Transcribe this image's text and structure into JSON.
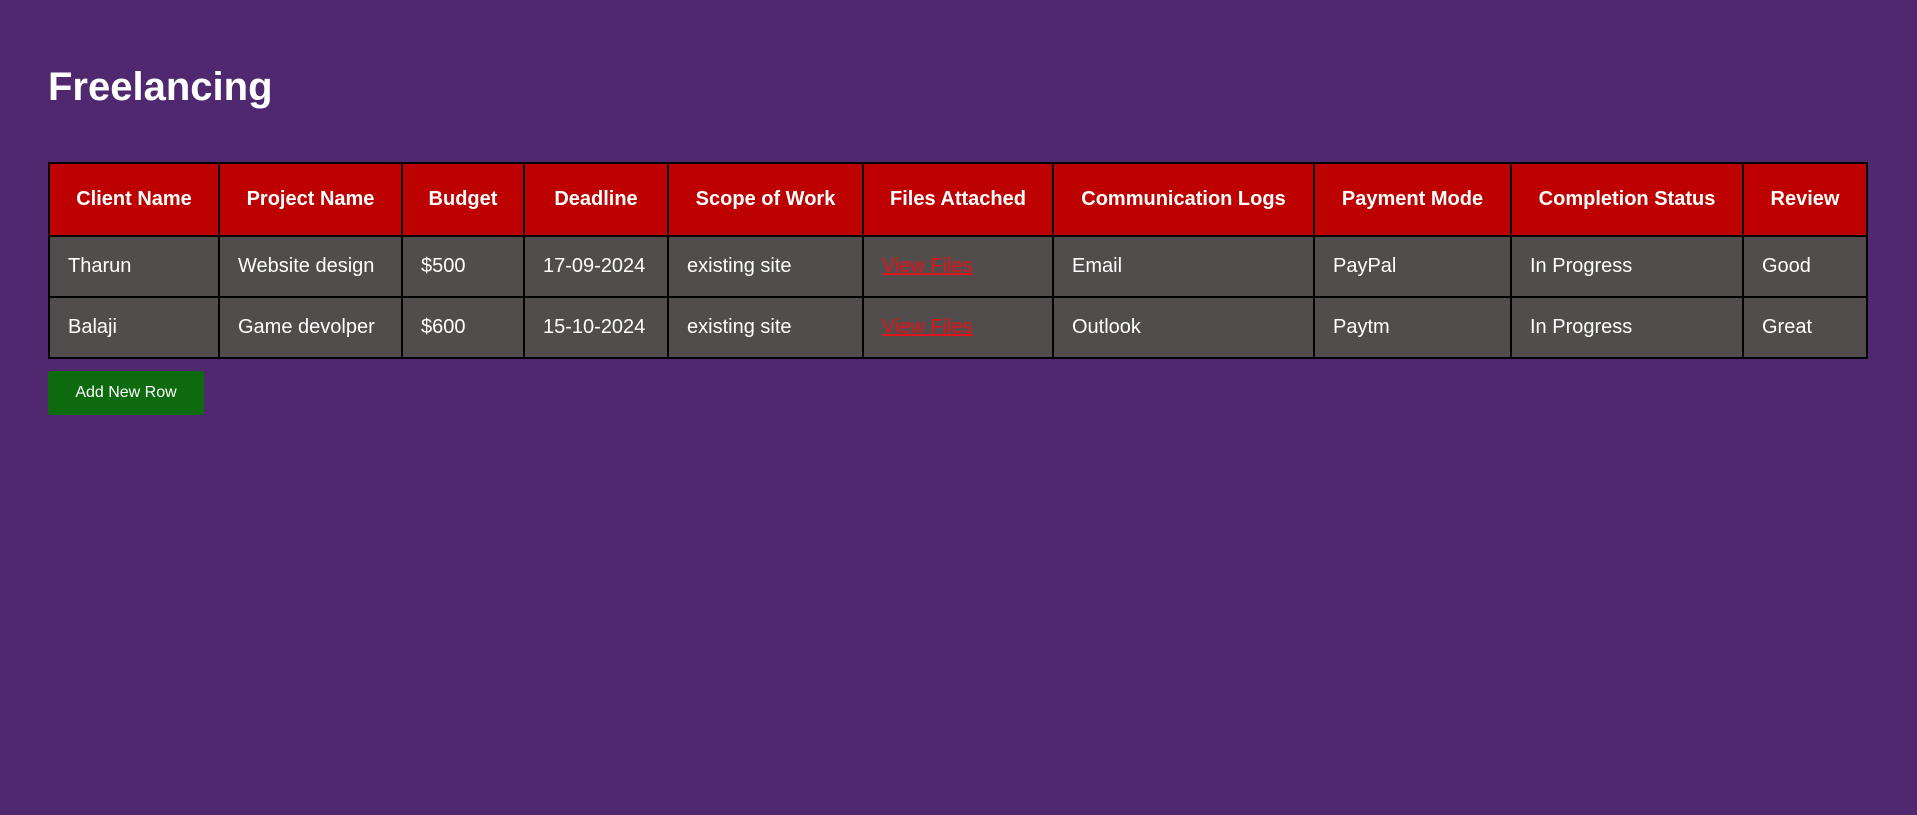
{
  "page": {
    "title": "Freelancing"
  },
  "table": {
    "headers": [
      "Client Name",
      "Project Name",
      "Budget",
      "Deadline",
      "Scope of Work",
      "Files Attached",
      "Communication Logs",
      "Payment Mode",
      "Completion Status",
      "Review"
    ],
    "rows": [
      {
        "client": "Tharun",
        "project": "Website design",
        "budget": "$500",
        "deadline": "17-09-2024",
        "scope": "existing site",
        "files": "View Files",
        "communication": "Email",
        "payment": "PayPal",
        "status": "In Progress",
        "review": "Good"
      },
      {
        "client": "Balaji",
        "project": "Game devolper",
        "budget": "$600",
        "deadline": "15-10-2024",
        "scope": "existing site",
        "files": "View Files",
        "communication": "Outlook",
        "payment": "Paytm",
        "status": "In Progress",
        "review": "Great"
      }
    ]
  },
  "actions": {
    "add_row_label": "Add New Row"
  },
  "colors": {
    "background": "#4f2870",
    "header": "#bd0000",
    "cell": "#524d4d",
    "link": "#e0131b",
    "button": "#0e6a0e"
  }
}
